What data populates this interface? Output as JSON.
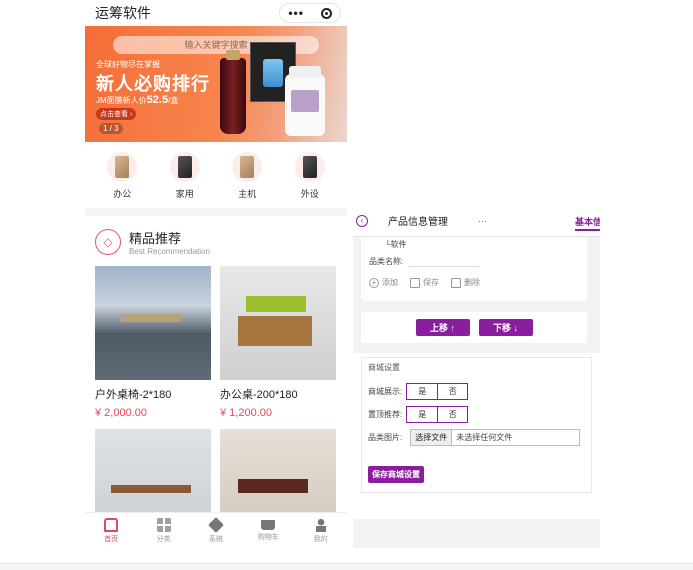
{
  "phone": {
    "app_title": "运筹软件",
    "capsule_dots": "•••",
    "banner": {
      "search_placeholder": "输入关键字搜索",
      "tagline": "全球好物尽在掌握",
      "headline": "新人必购排行",
      "subline_prefix": "JM面膜新人价",
      "subline_price": "52.5",
      "subline_suffix": "/盒",
      "cta": "点击查看 ›",
      "pager": "1 / 3"
    },
    "categories": [
      {
        "label": "办公",
        "icon": "phone-gold-icon"
      },
      {
        "label": "家用",
        "icon": "phone-dark-icon"
      },
      {
        "label": "主机",
        "icon": "phone-gold-icon"
      },
      {
        "label": "外设",
        "icon": "phone-dark-icon"
      }
    ],
    "recommend": {
      "title": "精品推荐",
      "subtitle": "Best Recommendation",
      "icon": "diamond-icon"
    },
    "products": [
      {
        "name": "户外桌椅-2*180",
        "price": "¥ 2,000.00"
      },
      {
        "name": "办公桌-200*180",
        "price": "¥ 1,200.00"
      },
      {
        "name": "",
        "price": ""
      },
      {
        "name": "",
        "price": ""
      }
    ],
    "tabbar": [
      {
        "label": "首页",
        "icon": "home-icon",
        "active": true
      },
      {
        "label": "分类",
        "icon": "grid-icon",
        "active": false
      },
      {
        "label": "系统",
        "icon": "layers-icon",
        "active": false
      },
      {
        "label": "购物车",
        "icon": "cart-icon",
        "active": false
      },
      {
        "label": "我的",
        "icon": "user-icon",
        "active": false
      }
    ]
  },
  "admin": {
    "back_icon": "back-arrow-icon",
    "title": "产品信息管理",
    "more": "···",
    "tab": "基本信",
    "tree_item": "└软件",
    "category_name_label": "品类名称:",
    "actions": {
      "add": "添加",
      "save": "保存",
      "delete": "删除"
    },
    "move_up": "上移 ↑",
    "move_down": "下移 ↓",
    "mall": {
      "legend": "商城设置",
      "display_label": "商城展示:",
      "top_label": "置顶推荐:",
      "yes": "是",
      "no": "否",
      "image_label": "品类图片:",
      "file_button": "选择文件",
      "file_status": "未选择任何文件",
      "save_button": "保存商城设置"
    }
  },
  "colors": {
    "accent_admin": "#8a1e9e",
    "accent_mall": "#e0485e",
    "banner": "#f56d38"
  }
}
